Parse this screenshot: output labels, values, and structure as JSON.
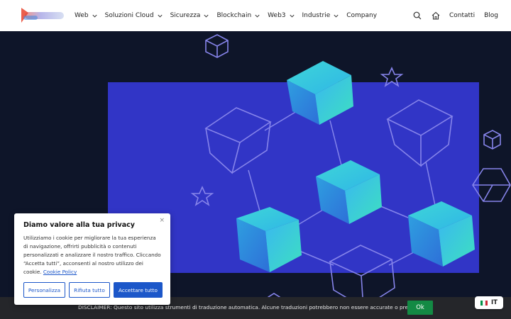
{
  "header": {
    "nav": [
      {
        "label": "Web",
        "has_menu": true
      },
      {
        "label": "Soluzioni Cloud",
        "has_menu": true
      },
      {
        "label": "Sicurezza",
        "has_menu": true
      },
      {
        "label": "Blockchain",
        "has_menu": true
      },
      {
        "label": "Web3",
        "has_menu": true
      },
      {
        "label": "Industrie",
        "has_menu": true
      },
      {
        "label": "Company",
        "has_menu": false
      }
    ],
    "right": {
      "search_icon": "search-icon",
      "home_icon": "home-icon",
      "contact": "Contatti",
      "blog": "Blog"
    }
  },
  "cookie": {
    "title": "Diamo valore alla tua privacy",
    "body": "Utilizziamo i cookie per migliorare la tua esperienza di navigazione, offrirti pubblicità o contenuti personalizzati e analizzare il nostro traffico. Cliccando “Accetta tutti”, acconsenti al nostro utilizzo dei cookie. ",
    "policy_link": "Cookie Policy",
    "close": "×",
    "customize": "Personalizza",
    "reject": "Rifiuta tutto",
    "accept": "Accettare tutto"
  },
  "disclaimer": {
    "text": "DISCLAIMER: Questo sito utilizza strumenti di traduzione automatica. Alcune traduzioni potrebbero non essere accurate o precise.",
    "ok": "Ok"
  },
  "language": {
    "code": "IT",
    "flag_colors": [
      "#009246",
      "#ffffff",
      "#ce2b37"
    ]
  },
  "colors": {
    "hero_bg": "#0e1529",
    "panel": "#3135c6",
    "outline": "#7f7ee8",
    "accept_button": "#1c57c9",
    "ok_button": "#138a44"
  }
}
